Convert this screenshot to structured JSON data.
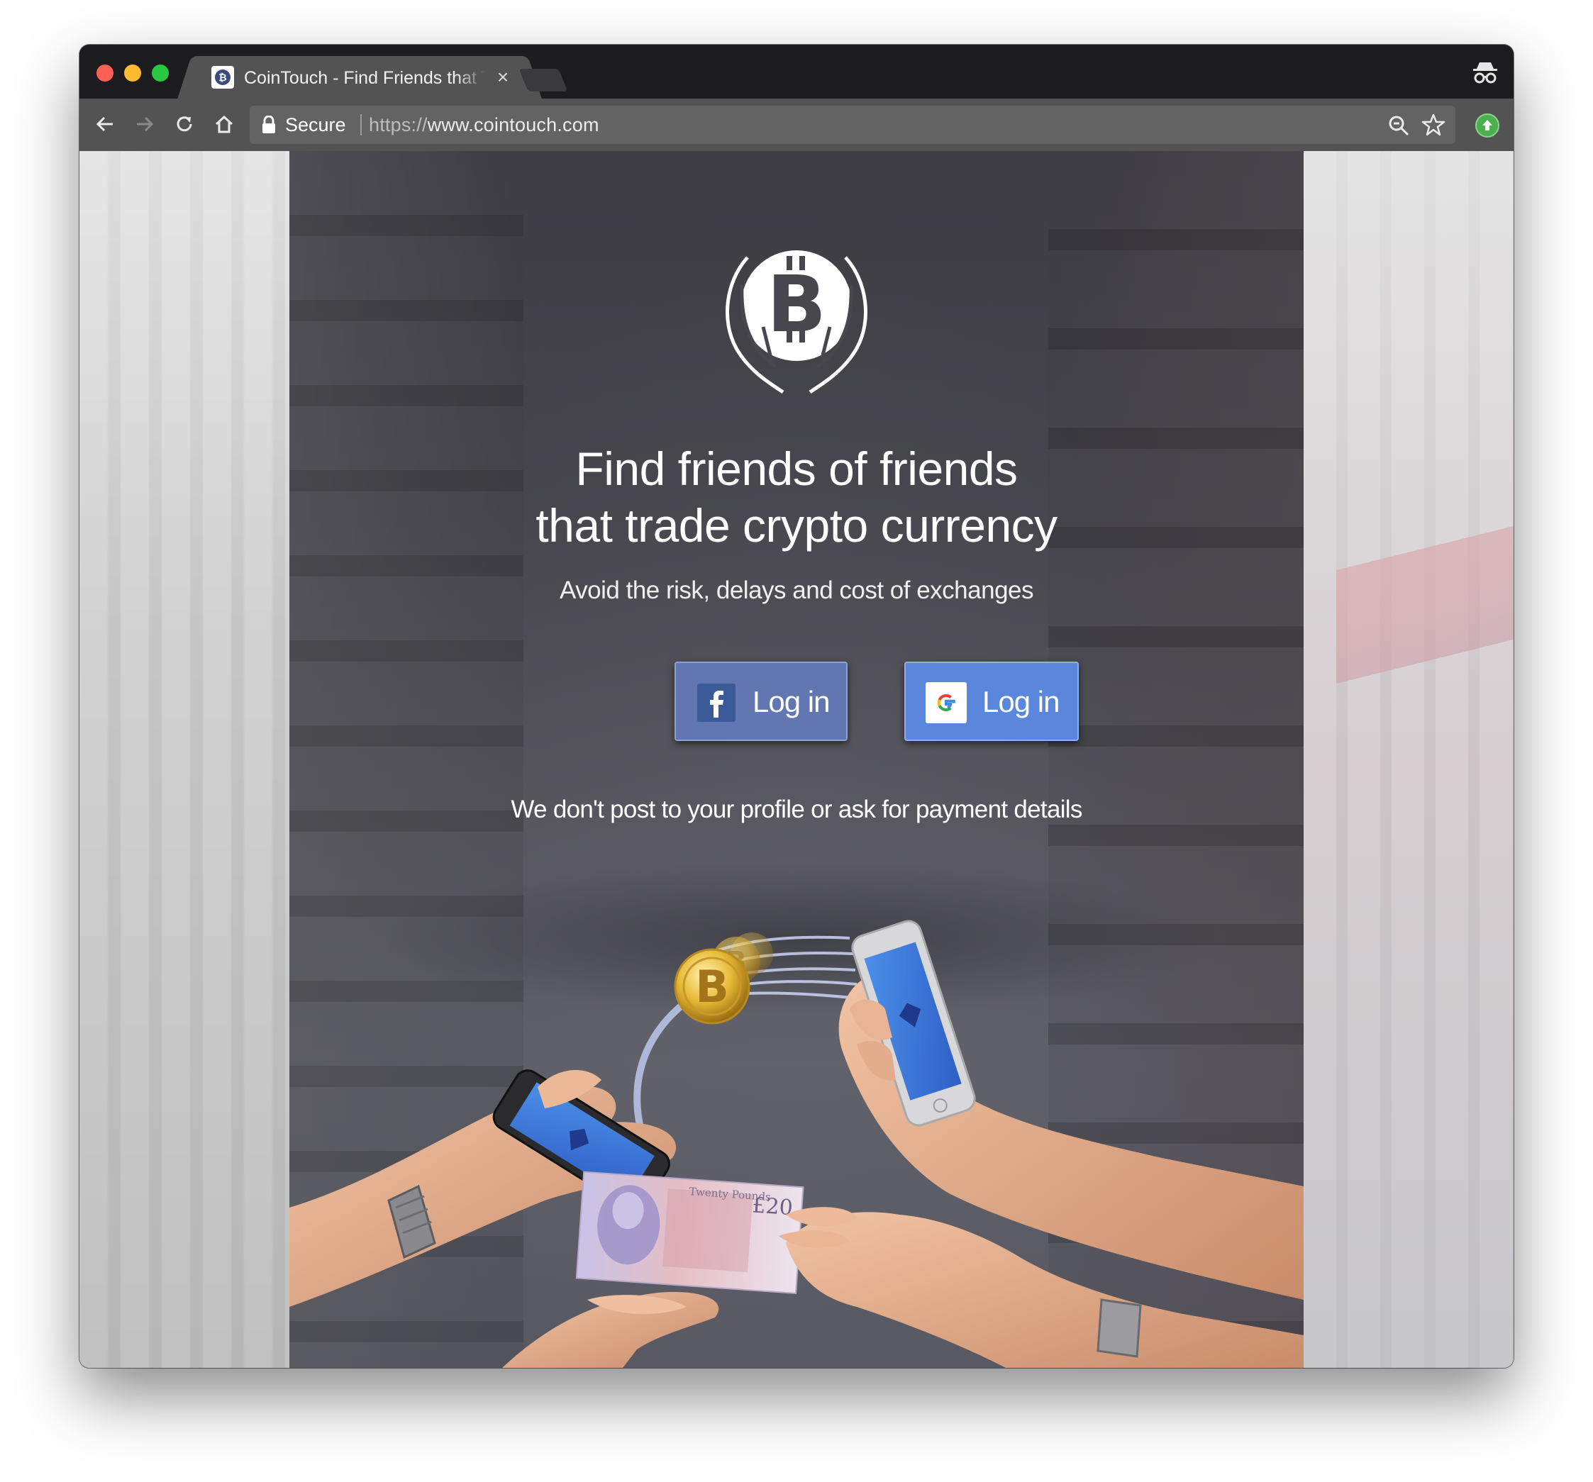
{
  "browser": {
    "tab_title": "CoinTouch - Find Friends that Trade Crypto Currency",
    "tab_close": "×",
    "secure_label": "Secure",
    "url_scheme": "https://",
    "url_host": "www.cointouch.com"
  },
  "hero": {
    "headline_line1": "Find friends of friends",
    "headline_line2": "that trade crypto currency",
    "subheadline": "Avoid the risk, delays and cost of exchanges",
    "facebook_login_label": "Log in",
    "google_login_label": "Log in",
    "disclaimer": "We don't post to your profile or ask for payment details"
  },
  "banknote": {
    "denomination": "£20",
    "caption": "Twenty Pounds"
  },
  "colors": {
    "facebook_button": "#6276b1",
    "google_button": "#5a86dc",
    "hero_overlay": "#45444b"
  },
  "icons": [
    "bitcoin-hands-logo-icon",
    "facebook-icon",
    "google-icon",
    "lock-icon",
    "zoom-icon",
    "star-icon",
    "incognito-icon"
  ]
}
